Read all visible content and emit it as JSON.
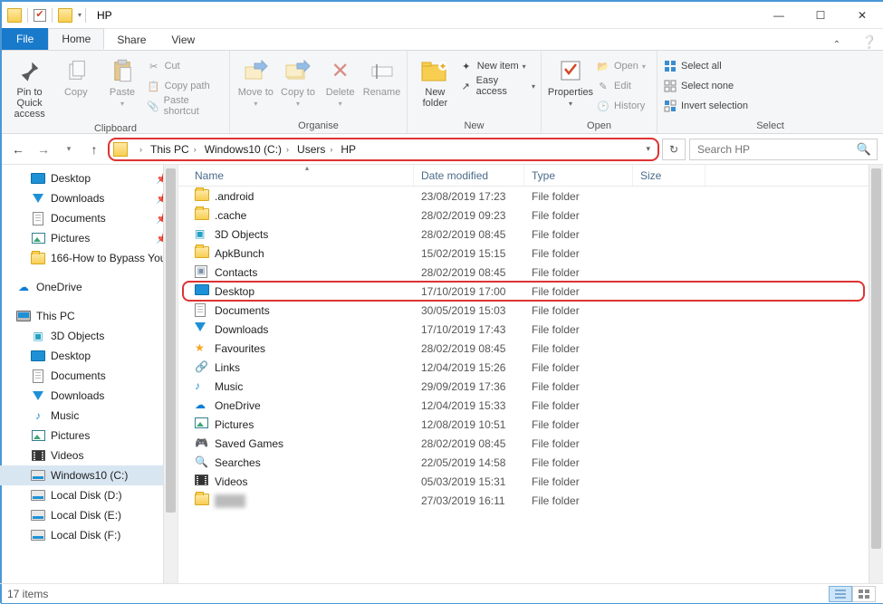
{
  "window": {
    "title": "HP"
  },
  "tabs": {
    "file": "File",
    "home": "Home",
    "share": "Share",
    "view": "View"
  },
  "ribbon": {
    "clipboard": {
      "label": "Clipboard",
      "pin": "Pin to Quick access",
      "copy": "Copy",
      "paste": "Paste",
      "cut": "Cut",
      "copypath": "Copy path",
      "pasteshortcut": "Paste shortcut"
    },
    "organise": {
      "label": "Organise",
      "moveto": "Move to",
      "copyto": "Copy to",
      "delete": "Delete",
      "rename": "Rename"
    },
    "new": {
      "label": "New",
      "newfolder": "New folder",
      "newitem": "New item",
      "easyaccess": "Easy access"
    },
    "open": {
      "label": "Open",
      "properties": "Properties",
      "open": "Open",
      "edit": "Edit",
      "history": "History"
    },
    "select": {
      "label": "Select",
      "selectall": "Select all",
      "selectnone": "Select none",
      "invert": "Invert selection"
    }
  },
  "breadcrumb": [
    "This PC",
    "Windows10 (C:)",
    "Users",
    "HP"
  ],
  "search": {
    "placeholder": "Search HP"
  },
  "columns": {
    "name": "Name",
    "date": "Date modified",
    "type": "Type",
    "size": "Size"
  },
  "nav": {
    "quick": [
      {
        "label": "Desktop",
        "icon": "desktop",
        "pin": true
      },
      {
        "label": "Downloads",
        "icon": "down",
        "pin": true
      },
      {
        "label": "Documents",
        "icon": "doc",
        "pin": true
      },
      {
        "label": "Pictures",
        "icon": "pic",
        "pin": true
      },
      {
        "label": "166-How to Bypass You",
        "icon": "folder",
        "pin": true
      }
    ],
    "onedrive": "OneDrive",
    "thispc": "This PC",
    "pcitems": [
      {
        "label": "3D Objects",
        "icon": "3d"
      },
      {
        "label": "Desktop",
        "icon": "desktop"
      },
      {
        "label": "Documents",
        "icon": "doc"
      },
      {
        "label": "Downloads",
        "icon": "down"
      },
      {
        "label": "Music",
        "icon": "music"
      },
      {
        "label": "Pictures",
        "icon": "pic"
      },
      {
        "label": "Videos",
        "icon": "video"
      },
      {
        "label": "Windows10 (C:)",
        "icon": "disk",
        "selected": true
      },
      {
        "label": "Local Disk (D:)",
        "icon": "disk"
      },
      {
        "label": "Local Disk (E:)",
        "icon": "disk"
      },
      {
        "label": "Local Disk (F:)",
        "icon": "disk"
      }
    ]
  },
  "files": [
    {
      "name": ".android",
      "date": "23/08/2019 17:23",
      "type": "File folder",
      "icon": "folder"
    },
    {
      "name": ".cache",
      "date": "28/02/2019 09:23",
      "type": "File folder",
      "icon": "folder"
    },
    {
      "name": "3D Objects",
      "date": "28/02/2019 08:45",
      "type": "File folder",
      "icon": "3d"
    },
    {
      "name": "ApkBunch",
      "date": "15/02/2019 15:15",
      "type": "File folder",
      "icon": "folder"
    },
    {
      "name": "Contacts",
      "date": "28/02/2019 08:45",
      "type": "File folder",
      "icon": "contacts"
    },
    {
      "name": "Desktop",
      "date": "17/10/2019 17:00",
      "type": "File folder",
      "icon": "desktop",
      "annot": true
    },
    {
      "name": "Documents",
      "date": "30/05/2019 15:03",
      "type": "File folder",
      "icon": "doc"
    },
    {
      "name": "Downloads",
      "date": "17/10/2019 17:43",
      "type": "File folder",
      "icon": "down"
    },
    {
      "name": "Favourites",
      "date": "28/02/2019 08:45",
      "type": "File folder",
      "icon": "star"
    },
    {
      "name": "Links",
      "date": "12/04/2019 15:26",
      "type": "File folder",
      "icon": "link"
    },
    {
      "name": "Music",
      "date": "29/09/2019 17:36",
      "type": "File folder",
      "icon": "music"
    },
    {
      "name": "OneDrive",
      "date": "12/04/2019 15:33",
      "type": "File folder",
      "icon": "onedrive"
    },
    {
      "name": "Pictures",
      "date": "12/08/2019 10:51",
      "type": "File folder",
      "icon": "pic"
    },
    {
      "name": "Saved Games",
      "date": "28/02/2019 08:45",
      "type": "File folder",
      "icon": "gear"
    },
    {
      "name": "Searches",
      "date": "22/05/2019 14:58",
      "type": "File folder",
      "icon": "search"
    },
    {
      "name": "Videos",
      "date": "05/03/2019 15:31",
      "type": "File folder",
      "icon": "video"
    },
    {
      "name": "████",
      "date": "27/03/2019 16:11",
      "type": "File folder",
      "icon": "folder",
      "blur": true
    }
  ],
  "status": {
    "count": "17 items"
  }
}
